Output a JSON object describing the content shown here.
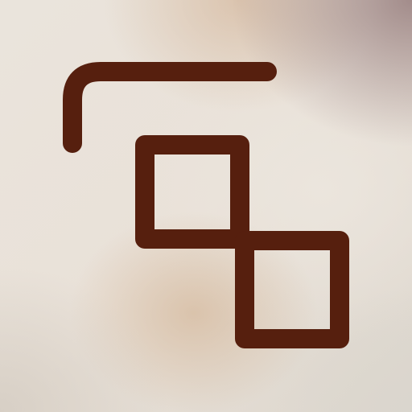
{
  "icon": {
    "name": "duplicate-squares-icon",
    "stroke_color": "#561f0e",
    "background_color": "#e9e2d9"
  }
}
